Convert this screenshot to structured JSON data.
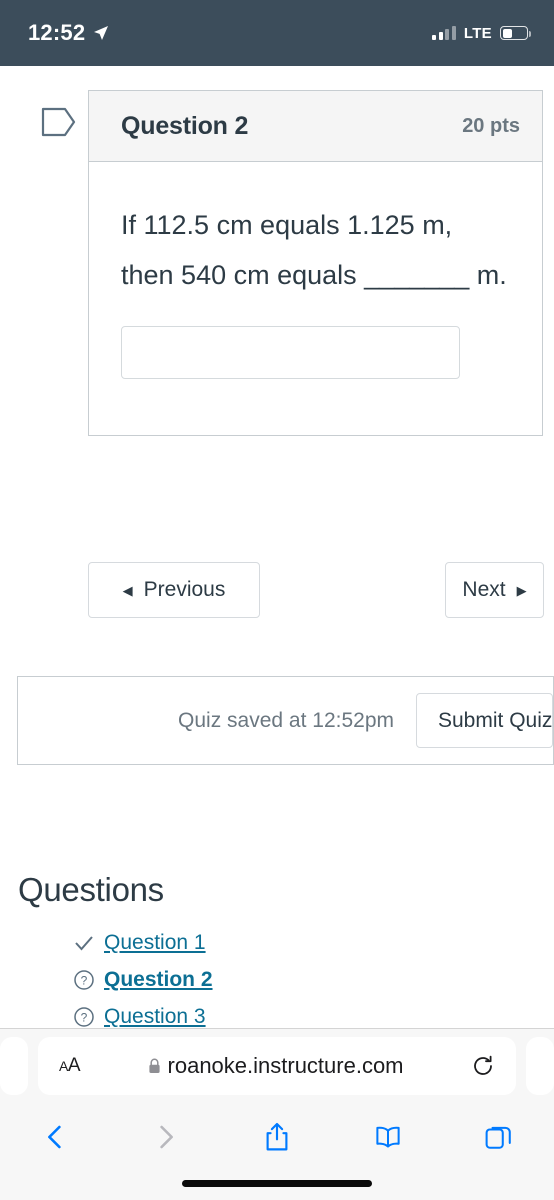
{
  "status_bar": {
    "time": "12:52",
    "location_icon": "location-arrow-icon",
    "signal_icon": "cellular-signal-icon",
    "network": "LTE",
    "battery_icon": "battery-icon"
  },
  "question_card": {
    "flag_icon": "question-flag-icon",
    "title": "Question 2",
    "points": "20 pts",
    "text": "If 112.5 cm equals 1.125 m, then 540 cm equals _______ m.",
    "answer_value": "",
    "answer_placeholder": ""
  },
  "navigation": {
    "previous_label": "Previous",
    "previous_icon": "triangle-left-icon",
    "next_label": "Next",
    "next_icon": "triangle-right-icon"
  },
  "submit_bar": {
    "saved_text": "Quiz saved at 12:52pm",
    "submit_label": "Submit Quiz"
  },
  "questions_panel": {
    "heading": "Questions",
    "items": [
      {
        "label": "Question 1",
        "status_icon": "check-icon",
        "current": false
      },
      {
        "label": "Question 2",
        "status_icon": "question-mark-circle-icon",
        "current": true
      },
      {
        "label": "Question 3",
        "status_icon": "question-mark-circle-icon",
        "current": false
      }
    ]
  },
  "browser": {
    "text_size_label": "AA",
    "lock_icon": "lock-icon",
    "url": "roanoke.instructure.com",
    "reload_icon": "reload-icon",
    "toolbar": {
      "back_icon": "chevron-left-icon",
      "forward_icon": "chevron-right-icon",
      "share_icon": "share-icon",
      "bookmarks_icon": "book-icon",
      "tabs_icon": "tabs-icon"
    }
  },
  "colors": {
    "status_bar_bg": "#3c4d5b",
    "link": "#0c6f94",
    "text": "#2d3b45",
    "muted": "#6b7780",
    "safari_blue": "#007aff",
    "border": "#c7cdd1"
  }
}
